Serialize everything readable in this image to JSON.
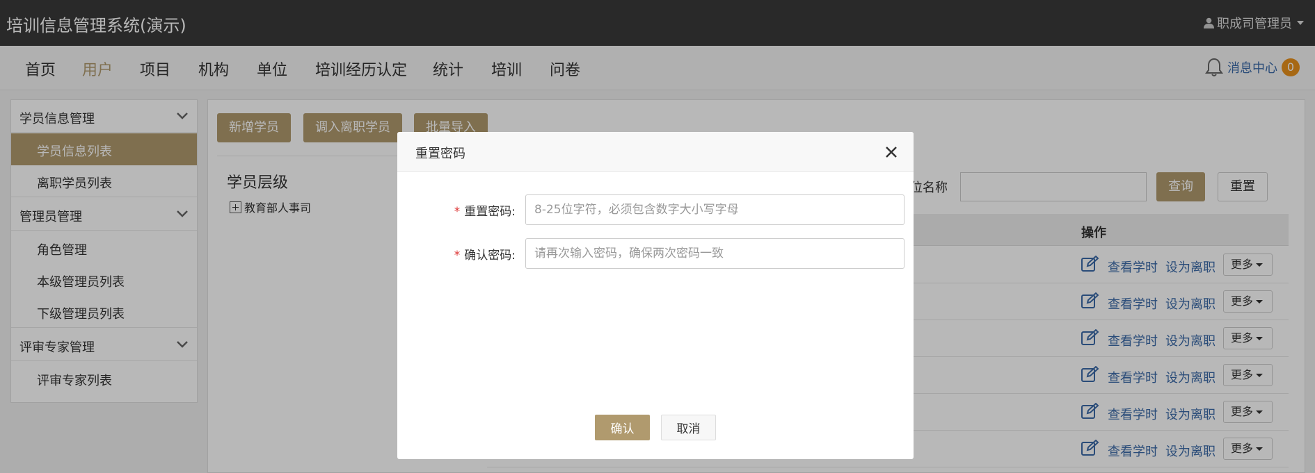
{
  "app": {
    "title": "培训信息管理系统(演示)",
    "user": "职成司管理员"
  },
  "nav": {
    "items": [
      "首页",
      "用户",
      "项目",
      "机构",
      "单位",
      "培训经历认定",
      "统计",
      "培训",
      "问卷"
    ],
    "active_index": 1,
    "message_center": "消息中心",
    "message_count": "0"
  },
  "sidebar": {
    "groups": [
      {
        "label": "学员信息管理",
        "items": [
          "学员信息列表",
          "离职学员列表"
        ]
      },
      {
        "label": "管理员管理",
        "items": [
          "角色管理",
          "本级管理员列表",
          "下级管理员列表"
        ]
      },
      {
        "label": "评审专家管理",
        "items": [
          "评审专家列表"
        ]
      }
    ],
    "active_item": "学员信息列表"
  },
  "toolbar": {
    "add": "新增学员",
    "transfer": "调入离职学员",
    "import": "批量导入"
  },
  "tree": {
    "title": "学员层级",
    "root": "教育部人事司"
  },
  "search": {
    "label": "位名称",
    "query": "查询",
    "reset": "重置"
  },
  "table": {
    "ops_header": "操作",
    "view_hours": "查看学时",
    "set_resigned": "设为离职",
    "more": "更多",
    "row_count": 6
  },
  "modal": {
    "title": "重置密码",
    "fields": [
      {
        "label": "重置密码:",
        "placeholder": "8-25位字符，必须包含数字大小写字母"
      },
      {
        "label": "确认密码:",
        "placeholder": "请再次输入密码，确保两次密码一致"
      }
    ],
    "confirm": "确认",
    "cancel": "取消"
  },
  "colors": {
    "accent": "#b09a6e",
    "topbar": "#3a3a3a",
    "link": "#3b6aa8",
    "badge": "#e8901c"
  }
}
